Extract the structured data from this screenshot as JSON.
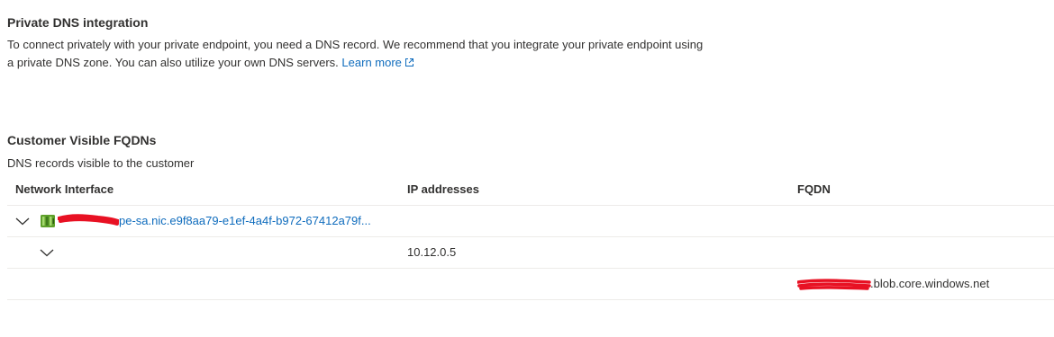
{
  "private_dns": {
    "title": "Private DNS integration",
    "description": "To connect privately with your private endpoint, you need a DNS record. We recommend that you integrate your private endpoint using a private DNS zone. You can also utilize your own DNS servers.",
    "learn_more": "Learn more",
    "learn_more_icon": "external-link-icon"
  },
  "fqdns": {
    "title": "Customer Visible FQDNs",
    "description": "DNS records visible to the customer",
    "columns": {
      "network_interface": "Network Interface",
      "ip_addresses": "IP addresses",
      "fqdn": "FQDN"
    },
    "rows": [
      {
        "network_interface": "pe-sa.nic.e9f8aa79-e1ef-4a4f-b972-67412a79f...",
        "icon": "network-interface-icon",
        "expanded": true
      },
      {
        "ip_address": "10.12.0.5",
        "expanded": true
      },
      {
        "fqdn": ".blob.core.windows.net"
      }
    ]
  },
  "colors": {
    "link": "#0f6cbd",
    "text": "#323130",
    "redaction": "#e81123",
    "nic_icon_green": "#5ea02a"
  }
}
